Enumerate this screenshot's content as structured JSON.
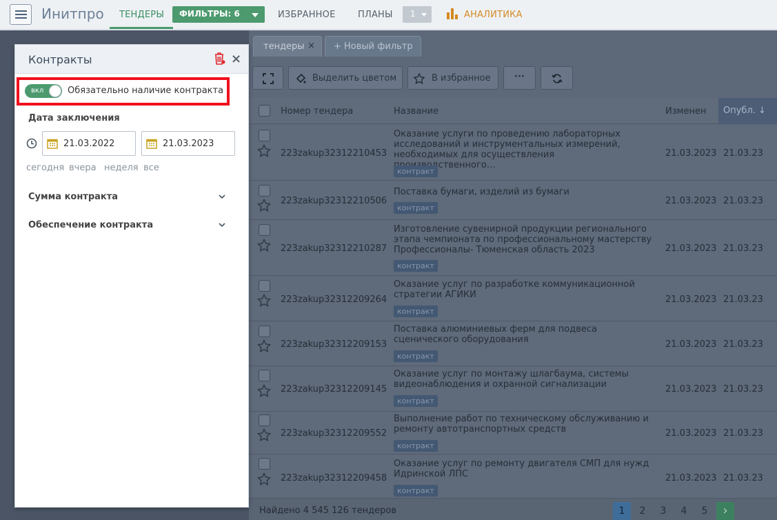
{
  "app": {
    "logo": "Инитпро"
  },
  "nav": {
    "tenders": "ТЕНДЕРЫ",
    "filters": "ФИЛЬТРЫ: 6",
    "favorites": "ИЗБРАННОЕ",
    "plans": "ПЛАНЫ",
    "plans_count": "1",
    "analytics": "АНАЛИТИКА"
  },
  "tabs": [
    {
      "label": "тендеры",
      "close": "×"
    },
    {
      "label": "+ Новый фильтр"
    }
  ],
  "toolbar": {
    "highlight_label": "Выделить цветом",
    "favorite_label": "В избранное",
    "more_label": "···"
  },
  "table": {
    "headers": {
      "number": "Номер тендера",
      "name": "Название",
      "changed": "Изменен",
      "published": "Опубл. ↓"
    },
    "rows": [
      {
        "number": "223zakup32312210453",
        "title": "Оказание услуги по проведению лабораторных исследований и инструментальных измерений, необходимых для осуществления производственного…",
        "badge": "контракт",
        "changed": "21.03.2023",
        "published": "21.03.23"
      },
      {
        "number": "223zakup32312210506",
        "title": "Поставка бумаги, изделий из бумаги",
        "badge": "контракт",
        "changed": "21.03.2023",
        "published": "21.03.23"
      },
      {
        "number": "223zakup32312210287",
        "title": "Изготовление сувенирной продукции регионального этапа чемпионата по профессиональному мастерству Профессионалы- Тюменская область 2023",
        "badge": "контракт",
        "changed": "21.03.2023",
        "published": "21.03.23"
      },
      {
        "number": "223zakup32312209264",
        "title": "Оказание услуг по разработке коммуникационной стратегии АГИКИ",
        "badge": "контракт",
        "changed": "21.03.2023",
        "published": "21.03.23"
      },
      {
        "number": "223zakup32312209153",
        "title": "Поставка алюминиевых ферм для подвеса сценического оборудования",
        "badge": "контракт",
        "changed": "21.03.2023",
        "published": "21.03.23"
      },
      {
        "number": "223zakup32312209145",
        "title": "Оказание услуг по монтажу шлагбаума, системы видеонаблюдения и охранной сигнализации",
        "badge": "контракт",
        "changed": "21.03.2023",
        "published": "21.03.23"
      },
      {
        "number": "223zakup32312209552",
        "title": "Выполнение работ по техническому обслуживанию и ремонту автотранспортных средств",
        "badge": "контракт",
        "changed": "21.03.2023",
        "published": "21.03.23"
      },
      {
        "number": "223zakup32312209458",
        "title": "Оказание услуг по ремонту двигателя СМП для нужд Идринской ЛПС",
        "badge": "контракт",
        "changed": "21.03.2023",
        "published": "21.03.23"
      }
    ]
  },
  "footer": {
    "found": "Найдено 4 545 126 тендеров",
    "pages": [
      "1",
      "2",
      "3",
      "4",
      "5"
    ],
    "next": "›"
  },
  "panel": {
    "title": "Контракты",
    "close": "×",
    "toggle_state": "вкл",
    "toggle_label": "Обязательно наличие контракта",
    "date_section": "Дата заключения",
    "date_from": "21.03.2022",
    "date_to": "21.03.2023",
    "quick": [
      "сегодня",
      "вчера",
      "неделя",
      "все"
    ],
    "sum_section": "Сумма контракта",
    "security_section": "Обеспечение контракта"
  },
  "colors": {
    "accent": "#4c9a6e",
    "highlight": "#f1101d",
    "analytics": "#d48a22"
  }
}
